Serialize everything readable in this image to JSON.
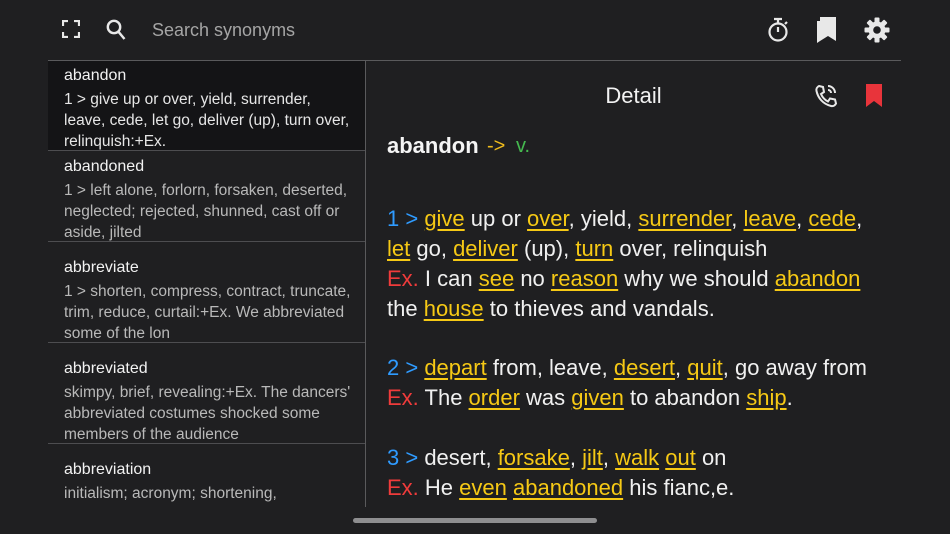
{
  "search": {
    "placeholder": "Search synonyms"
  },
  "icons": {
    "expand": "expand-icon",
    "search": "search-icon",
    "timer": "stopwatch-icon",
    "bookmarks": "bookmarks-icon",
    "settings": "gear-icon",
    "pronounce": "phone-sound-icon",
    "bookmark": "bookmark-icon"
  },
  "colors": {
    "link": "#f6c915",
    "number": "#2f9bff",
    "example": "#ef3b3b",
    "pos": "#45b94f",
    "bookmark": "#e8343b"
  },
  "list": [
    {
      "word": "abandon",
      "def": "1 > give up or over, yield, surrender, leave, cede, let go, deliver (up), turn over, relinquish:+Ex."
    },
    {
      "word": "abandoned",
      "def": "1 > left alone, forlorn, forsaken, deserted, neglected; rejected, shunned, cast off or aside, jilted"
    },
    {
      "word": "abbreviate",
      "def": "1 > shorten, compress, contract, truncate, trim, reduce, curtail:+Ex. We abbreviated some of the lon"
    },
    {
      "word": "abbreviated",
      "def": "skimpy, brief, revealing:+Ex. The dancers' abbreviated costumes shocked some members of the audience"
    },
    {
      "word": "abbreviation",
      "def": "initialism; acronym; shortening,"
    }
  ],
  "detail": {
    "title": "Detail",
    "word": "abandon",
    "arrow": "->",
    "pos": "v.",
    "senses": [
      {
        "num": "1 >",
        "syn": [
          {
            "t": "give",
            "l": true
          },
          {
            "t": " up or ",
            "l": false
          },
          {
            "t": "over",
            "l": true
          },
          {
            "t": ", yield, ",
            "l": false
          },
          {
            "t": "surrender",
            "l": true
          },
          {
            "t": ", ",
            "l": false
          },
          {
            "t": "leave",
            "l": true
          },
          {
            "t": ", ",
            "l": false
          },
          {
            "t": "cede",
            "l": true
          },
          {
            "t": ", ",
            "l": false
          },
          {
            "t": "let",
            "l": true
          },
          {
            "t": " go, ",
            "l": false
          },
          {
            "t": "deliver",
            "l": true
          },
          {
            "t": " (up), ",
            "l": false
          },
          {
            "t": "turn",
            "l": true
          },
          {
            "t": " over, relinquish",
            "l": false
          }
        ],
        "ex_label": "Ex.",
        "ex": [
          {
            "t": "I can ",
            "l": false
          },
          {
            "t": "see",
            "l": true
          },
          {
            "t": " no ",
            "l": false
          },
          {
            "t": "reason",
            "l": true
          },
          {
            "t": " why we should ",
            "l": false
          },
          {
            "t": "abandon",
            "l": true
          },
          {
            "t": " the ",
            "l": false
          },
          {
            "t": "house",
            "l": true
          },
          {
            "t": " to thieves and vandals.",
            "l": false
          }
        ]
      },
      {
        "num": "2 >",
        "syn": [
          {
            "t": "depart",
            "l": true
          },
          {
            "t": " from, leave, ",
            "l": false
          },
          {
            "t": "desert",
            "l": true
          },
          {
            "t": ", ",
            "l": false
          },
          {
            "t": "quit",
            "l": true
          },
          {
            "t": ", go away from",
            "l": false
          }
        ],
        "ex_label": "Ex.",
        "ex": [
          {
            "t": "The ",
            "l": false
          },
          {
            "t": "order",
            "l": true
          },
          {
            "t": " was ",
            "l": false
          },
          {
            "t": "given",
            "l": true
          },
          {
            "t": " to abandon ",
            "l": false
          },
          {
            "t": "ship",
            "l": true
          },
          {
            "t": ".",
            "l": false
          }
        ]
      },
      {
        "num": "3 >",
        "syn": [
          {
            "t": "desert, ",
            "l": false
          },
          {
            "t": "forsake",
            "l": true
          },
          {
            "t": ", ",
            "l": false
          },
          {
            "t": "jilt",
            "l": true
          },
          {
            "t": ", ",
            "l": false
          },
          {
            "t": "walk",
            "l": true
          },
          {
            "t": " ",
            "l": false
          },
          {
            "t": "out",
            "l": true
          },
          {
            "t": " on",
            "l": false
          }
        ],
        "ex_label": "Ex.",
        "ex": [
          {
            "t": "He ",
            "l": false
          },
          {
            "t": "even",
            "l": true
          },
          {
            "t": " ",
            "l": false
          },
          {
            "t": "abandoned",
            "l": true
          },
          {
            "t": " his fianc,e.",
            "l": false
          }
        ]
      }
    ]
  }
}
